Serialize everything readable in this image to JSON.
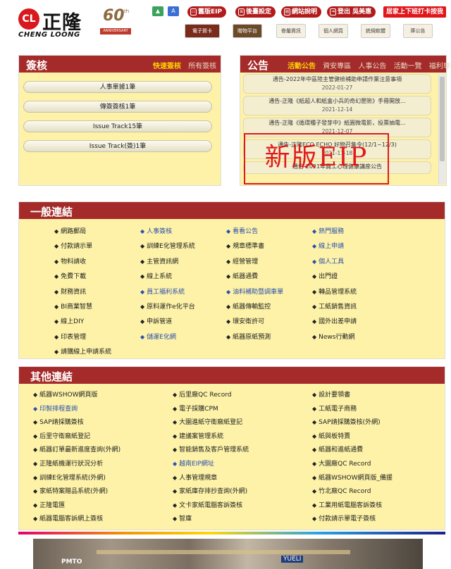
{
  "brand": {
    "name_cn": "正隆",
    "name_en": "CHENG LOONG",
    "anniversary": "60",
    "anniversary_sup": "th",
    "anniversary_ribbon": "ANNIVERSARY"
  },
  "header": {
    "pills": [
      {
        "label": "舊版EIP"
      },
      {
        "label": "後臺設定"
      },
      {
        "label": "網站說明"
      },
      {
        "label": "登出 吳美惠"
      }
    ],
    "alert_pill": "居家上下班打卡按我",
    "tiles": [
      {
        "label": "電子賀卡"
      },
      {
        "label": "贈物平台"
      },
      {
        "label": "眷屬資訊"
      },
      {
        "label": "個人網頁"
      },
      {
        "label": "統規軟體"
      },
      {
        "label": "庫公告"
      }
    ]
  },
  "sign_panel": {
    "title": "簽核",
    "tabs": [
      {
        "label": "快速簽核",
        "active": true
      },
      {
        "label": "所有簽核",
        "active": false
      }
    ],
    "items": [
      "人事單據1筆",
      "傳簽簽核1筆",
      "Issue Track15筆",
      "Issue Track(簽)1筆"
    ]
  },
  "announce_panel": {
    "title": "公告",
    "tabs": [
      {
        "label": "活動公告",
        "active": true
      },
      {
        "label": "資安專區",
        "active": false
      },
      {
        "label": "人事公告",
        "active": false
      },
      {
        "label": "活動一覽",
        "active": false
      },
      {
        "label": "福利專區",
        "active": false
      }
    ],
    "items": [
      {
        "title": "通告-2022年中區陸主管健檢補助申請作業注意事項",
        "date": "2022-01-27"
      },
      {
        "title": "通告-正隆《紙超人和紙盒小兵的奇幻歷險》手冊開放...",
        "date": "2021-12-14"
      },
      {
        "title": "通告-正隆《循環種子發芽中》紙圓微電影，投票抽電...",
        "date": "2021-12-07"
      },
      {
        "title": "通告-正隆ECO ECHO 好物召集令(12/1~12/3)",
        "date": "2021-11-18"
      },
      {
        "title": "通告-2021年員工心理健康講座公告",
        "date": ""
      }
    ],
    "stamp": "新版EIP"
  },
  "general_links": {
    "title": "一般連結",
    "columns": [
      [
        {
          "label": "網路郵局",
          "blue": false
        },
        {
          "label": "付款請示單",
          "blue": false
        },
        {
          "label": "物料請收",
          "blue": false
        },
        {
          "label": "免費下載",
          "blue": false
        },
        {
          "label": "財務資訊",
          "blue": false
        },
        {
          "label": "BI商業智慧",
          "blue": false
        },
        {
          "label": "線上DIY",
          "blue": false
        },
        {
          "label": "印表管理",
          "blue": false
        },
        {
          "label": "請購線上申請系統",
          "blue": false
        }
      ],
      [
        {
          "label": "人事簽核",
          "blue": true
        },
        {
          "label": "訓練E化管理系統",
          "blue": false
        },
        {
          "label": "主管資訊網",
          "blue": false
        },
        {
          "label": "線上系統",
          "blue": false
        },
        {
          "label": "員工福利系統",
          "blue": true
        },
        {
          "label": "原料運作e化平台",
          "blue": false
        },
        {
          "label": "申訴管道",
          "blue": false
        },
        {
          "label": "儲運E化網",
          "blue": true
        }
      ],
      [
        {
          "label": "看看公告",
          "blue": true
        },
        {
          "label": "規章標準書",
          "blue": false
        },
        {
          "label": "經營管理",
          "blue": false
        },
        {
          "label": "紙器通費",
          "blue": false
        },
        {
          "label": "油料補助暨調車單",
          "blue": true
        },
        {
          "label": "紙器傳輸監控",
          "blue": false
        },
        {
          "label": "環安衛許可",
          "blue": false
        },
        {
          "label": "紙器原紙預測",
          "blue": false
        }
      ],
      [
        {
          "label": "熱門服務",
          "blue": true
        },
        {
          "label": "線上申請",
          "blue": true
        },
        {
          "label": "個人工具",
          "blue": true
        },
        {
          "label": "出門證",
          "blue": false
        },
        {
          "label": "轉品管理系統",
          "blue": false
        },
        {
          "label": "工紙銷售資訊",
          "blue": false
        },
        {
          "label": "國外出差申請",
          "blue": false
        },
        {
          "label": "News行動網",
          "blue": false
        }
      ]
    ]
  },
  "other_links": {
    "title": "其他連結",
    "columns": [
      [
        {
          "label": "紙器WSHOW網頁版",
          "blue": false
        },
        {
          "label": "印製排程查詢",
          "blue": true
        },
        {
          "label": "SAP請採購簽核",
          "blue": false
        },
        {
          "label": "后里守衛廠紙登記",
          "blue": false
        },
        {
          "label": "紙器訂單最新進度查詢(外網)",
          "blue": false
        },
        {
          "label": "正隆紙機運行狀況分析",
          "blue": false
        },
        {
          "label": "訓練E化管理系統(外網)",
          "blue": false
        },
        {
          "label": "家紙特案贈品系統(外網)",
          "blue": false
        },
        {
          "label": "正隆電匯",
          "blue": false
        },
        {
          "label": "紙器電腦客訴網上簽核",
          "blue": false
        }
      ],
      [
        {
          "label": "后里廠QC Record",
          "blue": false
        },
        {
          "label": "電子採購CPM",
          "blue": false
        },
        {
          "label": "大園進紙守衛廠紙登記",
          "blue": false
        },
        {
          "label": "建議案管理系統",
          "blue": false
        },
        {
          "label": "智能銷售及客戶管理系統",
          "blue": false
        },
        {
          "label": "越南EIP網址",
          "blue": true
        },
        {
          "label": "人事管理規章",
          "blue": false
        },
        {
          "label": "家紙庫存排抄查詢(外網)",
          "blue": false
        },
        {
          "label": "文卡家紙電腦客訴簽核",
          "blue": false
        },
        {
          "label": "智庫",
          "blue": false
        }
      ],
      [
        {
          "label": "設計要領書",
          "blue": false
        },
        {
          "label": "工紙電子商務",
          "blue": false
        },
        {
          "label": "SAP請採購簽核(外網)",
          "blue": false
        },
        {
          "label": "紙與板特賣",
          "blue": false
        },
        {
          "label": "紙器和進紙通費",
          "blue": false
        },
        {
          "label": "大園廠QC Record",
          "blue": false
        },
        {
          "label": "紙器WSHOW網頁版_備援",
          "blue": false
        },
        {
          "label": "竹北廠QC Record",
          "blue": false
        },
        {
          "label": "工業用紙電腦客訴簽核",
          "blue": false
        },
        {
          "label": "付款請示單電子簽核",
          "blue": false
        }
      ]
    ]
  }
}
